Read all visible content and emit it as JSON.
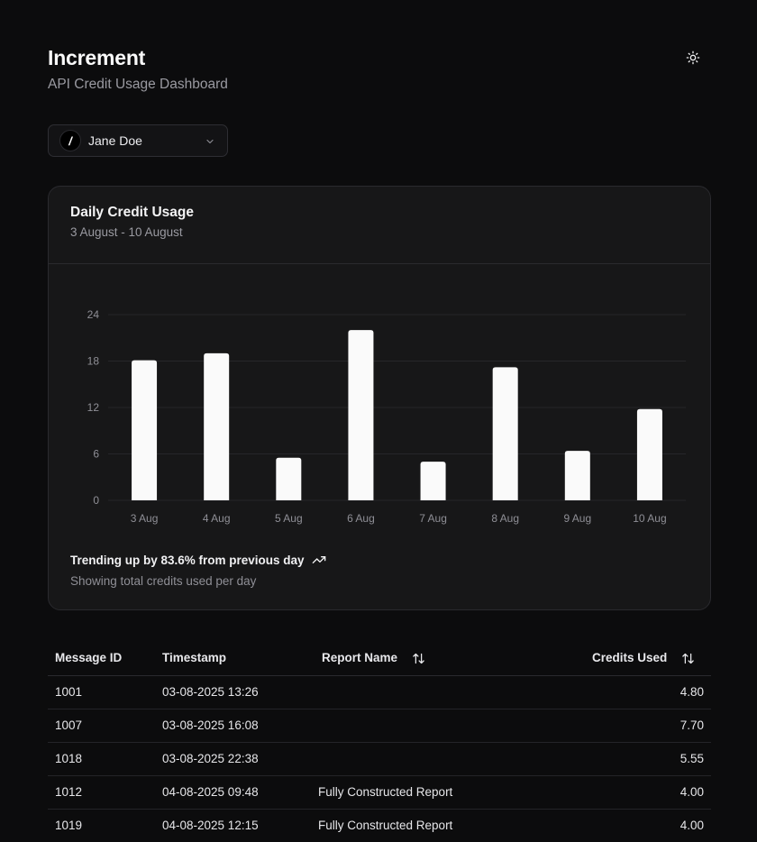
{
  "header": {
    "title": "Increment",
    "subtitle": "API Credit Usage Dashboard",
    "theme_toggle_icon": "sun-icon"
  },
  "user_select": {
    "avatar_text": "/",
    "selected": "Jane Doe",
    "chevron_icon": "chevron-down-icon"
  },
  "card": {
    "title": "Daily Credit Usage",
    "date_range": "3 August - 10 August",
    "trend_text": "Trending up by 83.6% from previous day",
    "trend_icon": "trending-up-icon",
    "note": "Showing total credits used per day"
  },
  "chart_data": {
    "type": "bar",
    "categories": [
      "3 Aug",
      "4 Aug",
      "5 Aug",
      "6 Aug",
      "7 Aug",
      "8 Aug",
      "9 Aug",
      "10 Aug"
    ],
    "values": [
      18.1,
      19.0,
      5.5,
      22.0,
      5.0,
      17.2,
      6.4,
      11.8
    ],
    "yticks": [
      0,
      6,
      12,
      18,
      24
    ],
    "ylim": [
      0,
      24
    ],
    "grid": true,
    "bar_color": "#fafafa"
  },
  "table": {
    "headers": {
      "message_id": "Message ID",
      "timestamp": "Timestamp",
      "report_name": "Report Name",
      "credits_used": "Credits Used"
    },
    "rows": [
      {
        "message_id": "1001",
        "timestamp": "03-08-2025 13:26",
        "report_name": "",
        "credits_used": "4.80"
      },
      {
        "message_id": "1007",
        "timestamp": "03-08-2025 16:08",
        "report_name": "",
        "credits_used": "7.70"
      },
      {
        "message_id": "1018",
        "timestamp": "03-08-2025 22:38",
        "report_name": "",
        "credits_used": "5.55"
      },
      {
        "message_id": "1012",
        "timestamp": "04-08-2025 09:48",
        "report_name": "Fully Constructed Report",
        "credits_used": "4.00"
      },
      {
        "message_id": "1019",
        "timestamp": "04-08-2025 12:15",
        "report_name": "Fully Constructed Report",
        "credits_used": "4.00"
      }
    ]
  },
  "colors": {
    "background": "#0c0c0d",
    "card": "#171718",
    "border": "#2a2a2e",
    "muted_text": "#9a9aa1",
    "bar": "#fafafa"
  }
}
